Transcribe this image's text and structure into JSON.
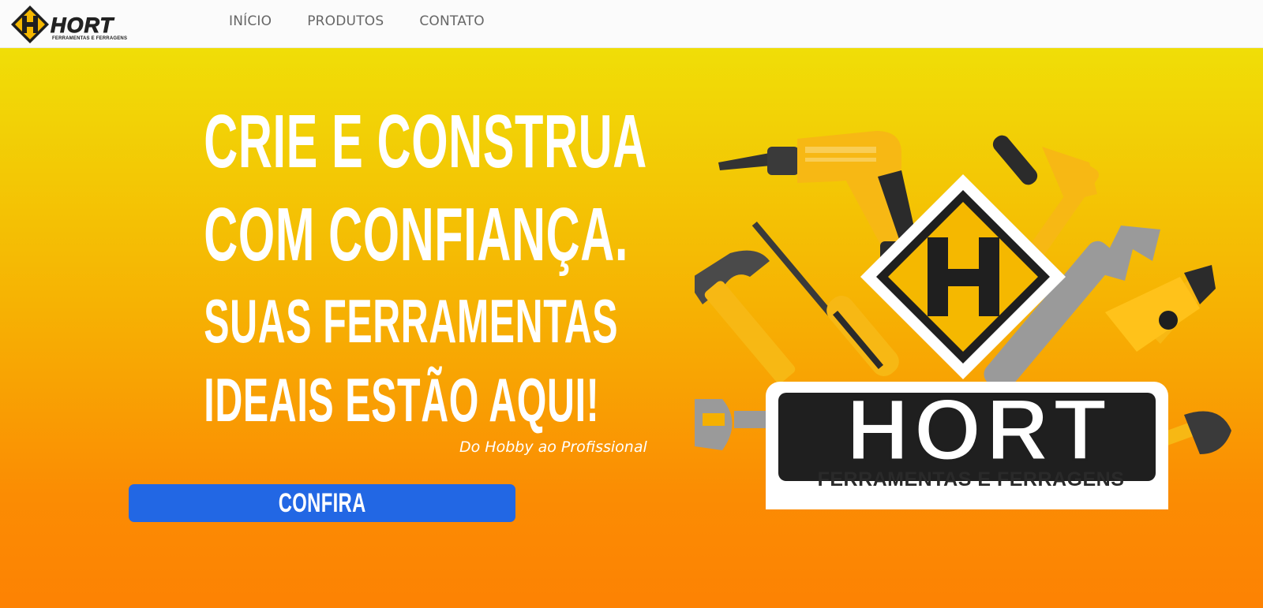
{
  "nav": {
    "logo_text": "HORT",
    "logo_subtitle": "FERRAMENTAS E FERRAGENS",
    "links": [
      "INÍCIO",
      "PRODUTOS",
      "CONTATO"
    ]
  },
  "hero": {
    "lines": [
      "CRIE E CONSTRUA",
      "COM CONFIANÇA.",
      "SUAS FERRAMENTAS",
      "IDEAIS ESTÃO AQUI!"
    ],
    "tagline": "Do Hobby ao Profissional",
    "cta_label": "CONFIRA"
  },
  "brand_art": {
    "wordmark": "HORT",
    "subtitle": "FERRAMENTAS E FERRAGENS",
    "icons": [
      "drill-icon",
      "wrench-icon",
      "screwdriver-icon",
      "hammer-icon",
      "pliers-icon",
      "spanner-icon",
      "pipe-wrench-icon"
    ]
  },
  "colors": {
    "gradient_top": "#f0de07",
    "gradient_bottom": "#fd8203",
    "cta_blue": "#2267e4",
    "brand_yellow": "#f5b800",
    "brand_dark": "#2a2a2a",
    "nav_background": "#fbfbfb",
    "nav_text": "#666666"
  }
}
